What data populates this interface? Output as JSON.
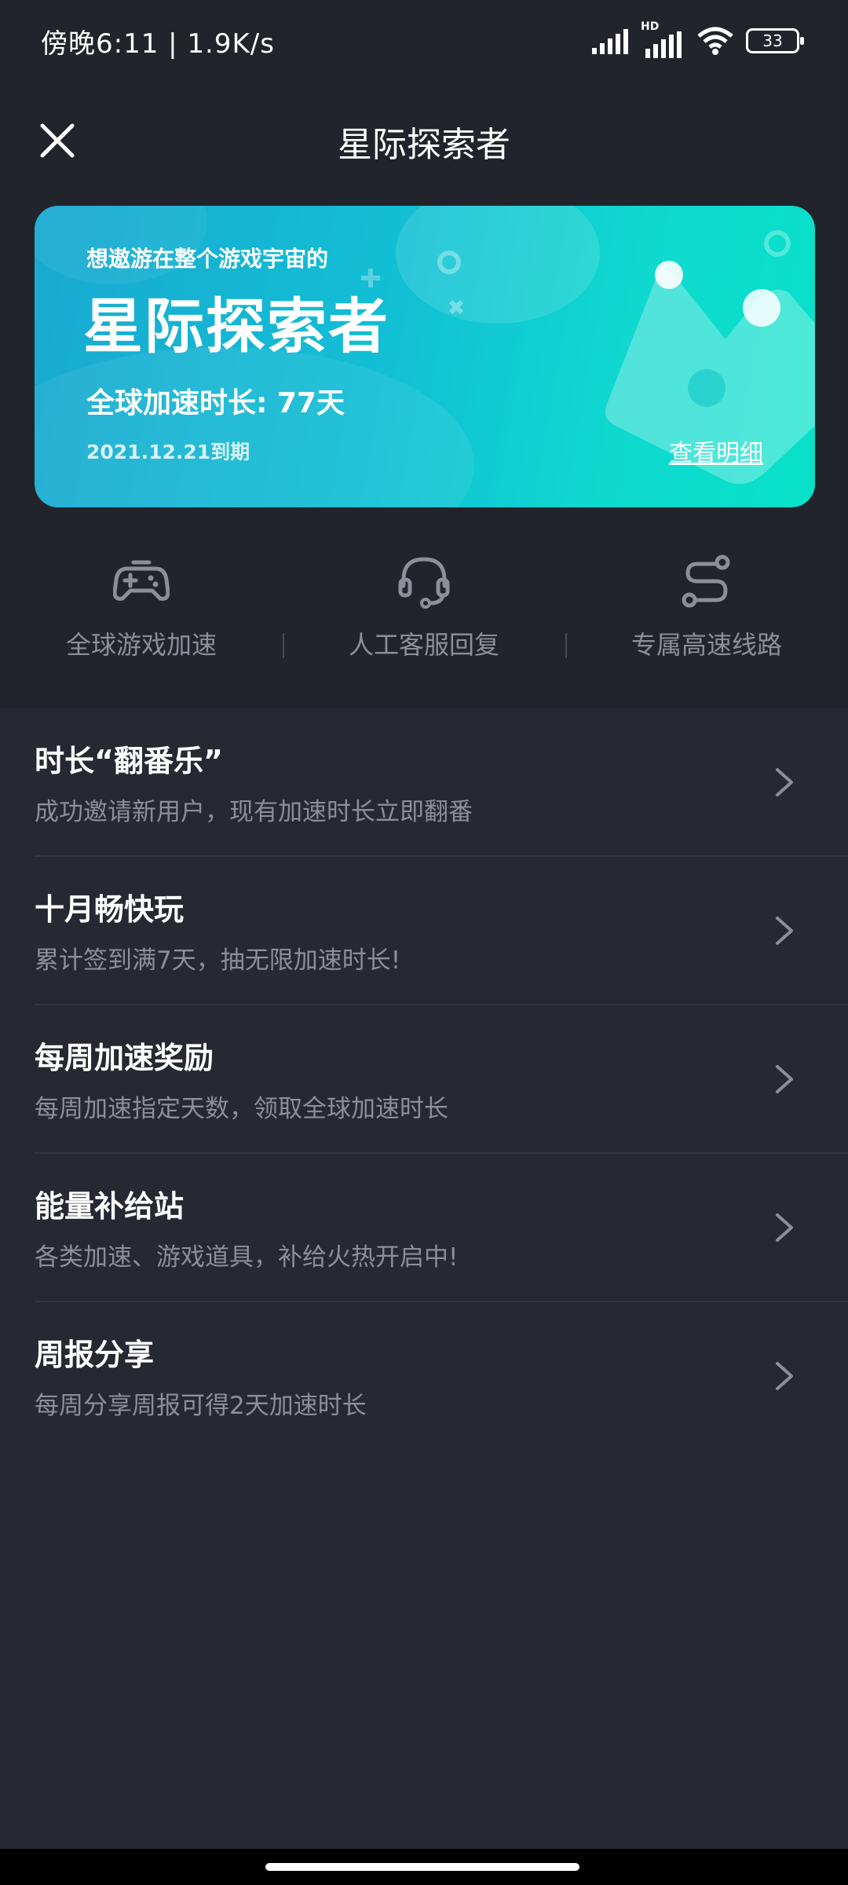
{
  "status_bar": {
    "time": "傍晚6:11 | 1.9K/s",
    "hd_label": "HD",
    "battery": "33"
  },
  "header": {
    "title": "星际探索者"
  },
  "hero": {
    "subtitle": "想遨游在整个游戏宇宙的",
    "title": "星际探索者",
    "duration": "全球加速时长: 77天",
    "expire": "2021.12.21到期",
    "detail_link": "查看明细"
  },
  "features": [
    {
      "label": "全球游戏加速",
      "icon": "gamepad-icon"
    },
    {
      "label": "人工客服回复",
      "icon": "headset-icon"
    },
    {
      "label": "专属高速线路",
      "icon": "route-icon"
    }
  ],
  "list": [
    {
      "title": "时长“翻番乐”",
      "desc": "成功邀请新用户，现有加速时长立即翻番"
    },
    {
      "title": "十月畅快玩",
      "desc": "累计签到满7天，抽无限加速时长!"
    },
    {
      "title": "每周加速奖励",
      "desc": "每周加速指定天数，领取全球加速时长"
    },
    {
      "title": "能量补给站",
      "desc": "各类加速、游戏道具，补给火热开启中!"
    },
    {
      "title": "周报分享",
      "desc": "每周分享周报可得2天加速时长"
    }
  ],
  "colors": {
    "background": "#272932",
    "header_bg": "#22242c",
    "accent_start": "#19a9d1",
    "accent_end": "#07e1c9",
    "secondary_text": "#8d8f98"
  }
}
